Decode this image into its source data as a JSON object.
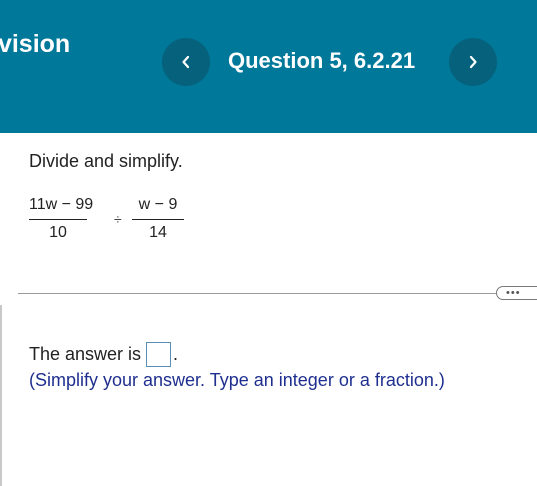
{
  "header": {
    "title": "ivision",
    "question_label": "Question 5, 6.2.21",
    "bg_color": "#007899",
    "button_color": "#06627c",
    "prev_icon": "chevron-left-icon",
    "next_icon": "chevron-right-icon"
  },
  "problem": {
    "prompt": "Divide and simplify.",
    "fraction1": {
      "numerator": "11w − 99",
      "denominator": "10"
    },
    "operator": "÷",
    "fraction2": {
      "numerator": "w − 9",
      "denominator": "14"
    }
  },
  "more_button": {
    "label": "•••"
  },
  "answer": {
    "prefix": "The answer is",
    "value": "",
    "suffix": ".",
    "hint": "(Simplify your answer. Type an integer or a fraction.)",
    "hint_color": "#1f2f8f"
  }
}
